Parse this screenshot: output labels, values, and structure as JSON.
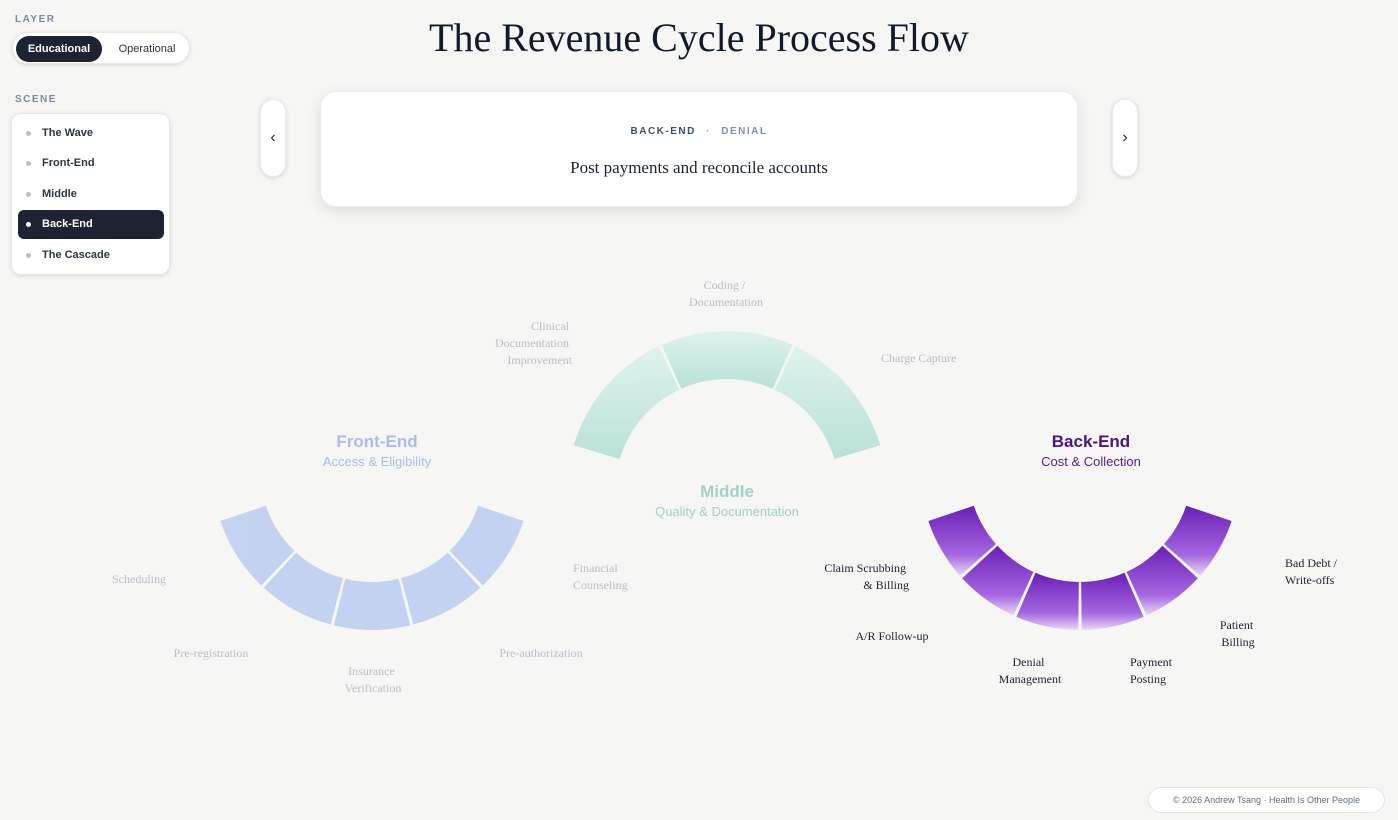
{
  "layer": {
    "label": "LAYER",
    "options": [
      "Educational",
      "Operational"
    ],
    "selected": "Educational"
  },
  "scene": {
    "label": "SCENE",
    "items": [
      "The Wave",
      "Front-End",
      "Middle",
      "Back-End",
      "The Cascade"
    ],
    "selected": "Back-End"
  },
  "title": "The Revenue Cycle Process Flow",
  "card": {
    "section": "BACK-END",
    "separator": "·",
    "category": "DENIAL",
    "text": "Post payments and reconcile accounts"
  },
  "nav": {
    "prev_icon": "chevron-left-icon",
    "next_icon": "chevron-right-icon"
  },
  "groups": {
    "front": {
      "title": "Front-End",
      "subtitle": "Access & Eligibility",
      "color": "#9db3e8"
    },
    "middle": {
      "title": "Middle",
      "subtitle": "Quality & Documentation",
      "color": "#8fd3c6"
    },
    "back": {
      "title": "Back-End",
      "subtitle": "Cost & Collection",
      "color": "#7a2fbf"
    }
  },
  "stages": {
    "front": [
      [
        "Scheduling"
      ],
      [
        "Pre-registration"
      ],
      [
        "Insurance",
        "Verification"
      ],
      [
        "Pre-authorization"
      ],
      [
        "Financial",
        "Counseling"
      ]
    ],
    "middle": [
      [
        "Clinical",
        "Documentation",
        "Improvement"
      ],
      [
        "Coding /",
        "Documentation"
      ],
      [
        "Charge Capture"
      ]
    ],
    "back": [
      [
        "Claim Scrubbing",
        "& Billing"
      ],
      [
        "A/R Follow-up"
      ],
      [
        "Denial",
        "Management"
      ],
      [
        "Payment",
        "Posting"
      ],
      [
        "Patient",
        "Billing"
      ],
      [
        "Bad Debt /",
        "Write-offs"
      ]
    ]
  },
  "footer": "© 2026 Andrew Tsang · Health Is Other People"
}
